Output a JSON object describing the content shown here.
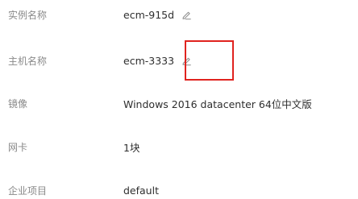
{
  "instance": {
    "rows": [
      {
        "label": "实例名称",
        "value": "ecm-915d",
        "editable": true
      },
      {
        "label": "主机名称",
        "value": "ecm-3333",
        "editable": true
      },
      {
        "label": "镜像",
        "value": "Windows 2016 datacenter 64位中文版",
        "editable": false
      },
      {
        "label": "网卡",
        "value": "1块",
        "editable": false
      },
      {
        "label": "企业项目",
        "value": "default",
        "editable": false
      }
    ],
    "edit_icon": "pencil-edit-icon",
    "highlight_color": "#e0231f"
  }
}
